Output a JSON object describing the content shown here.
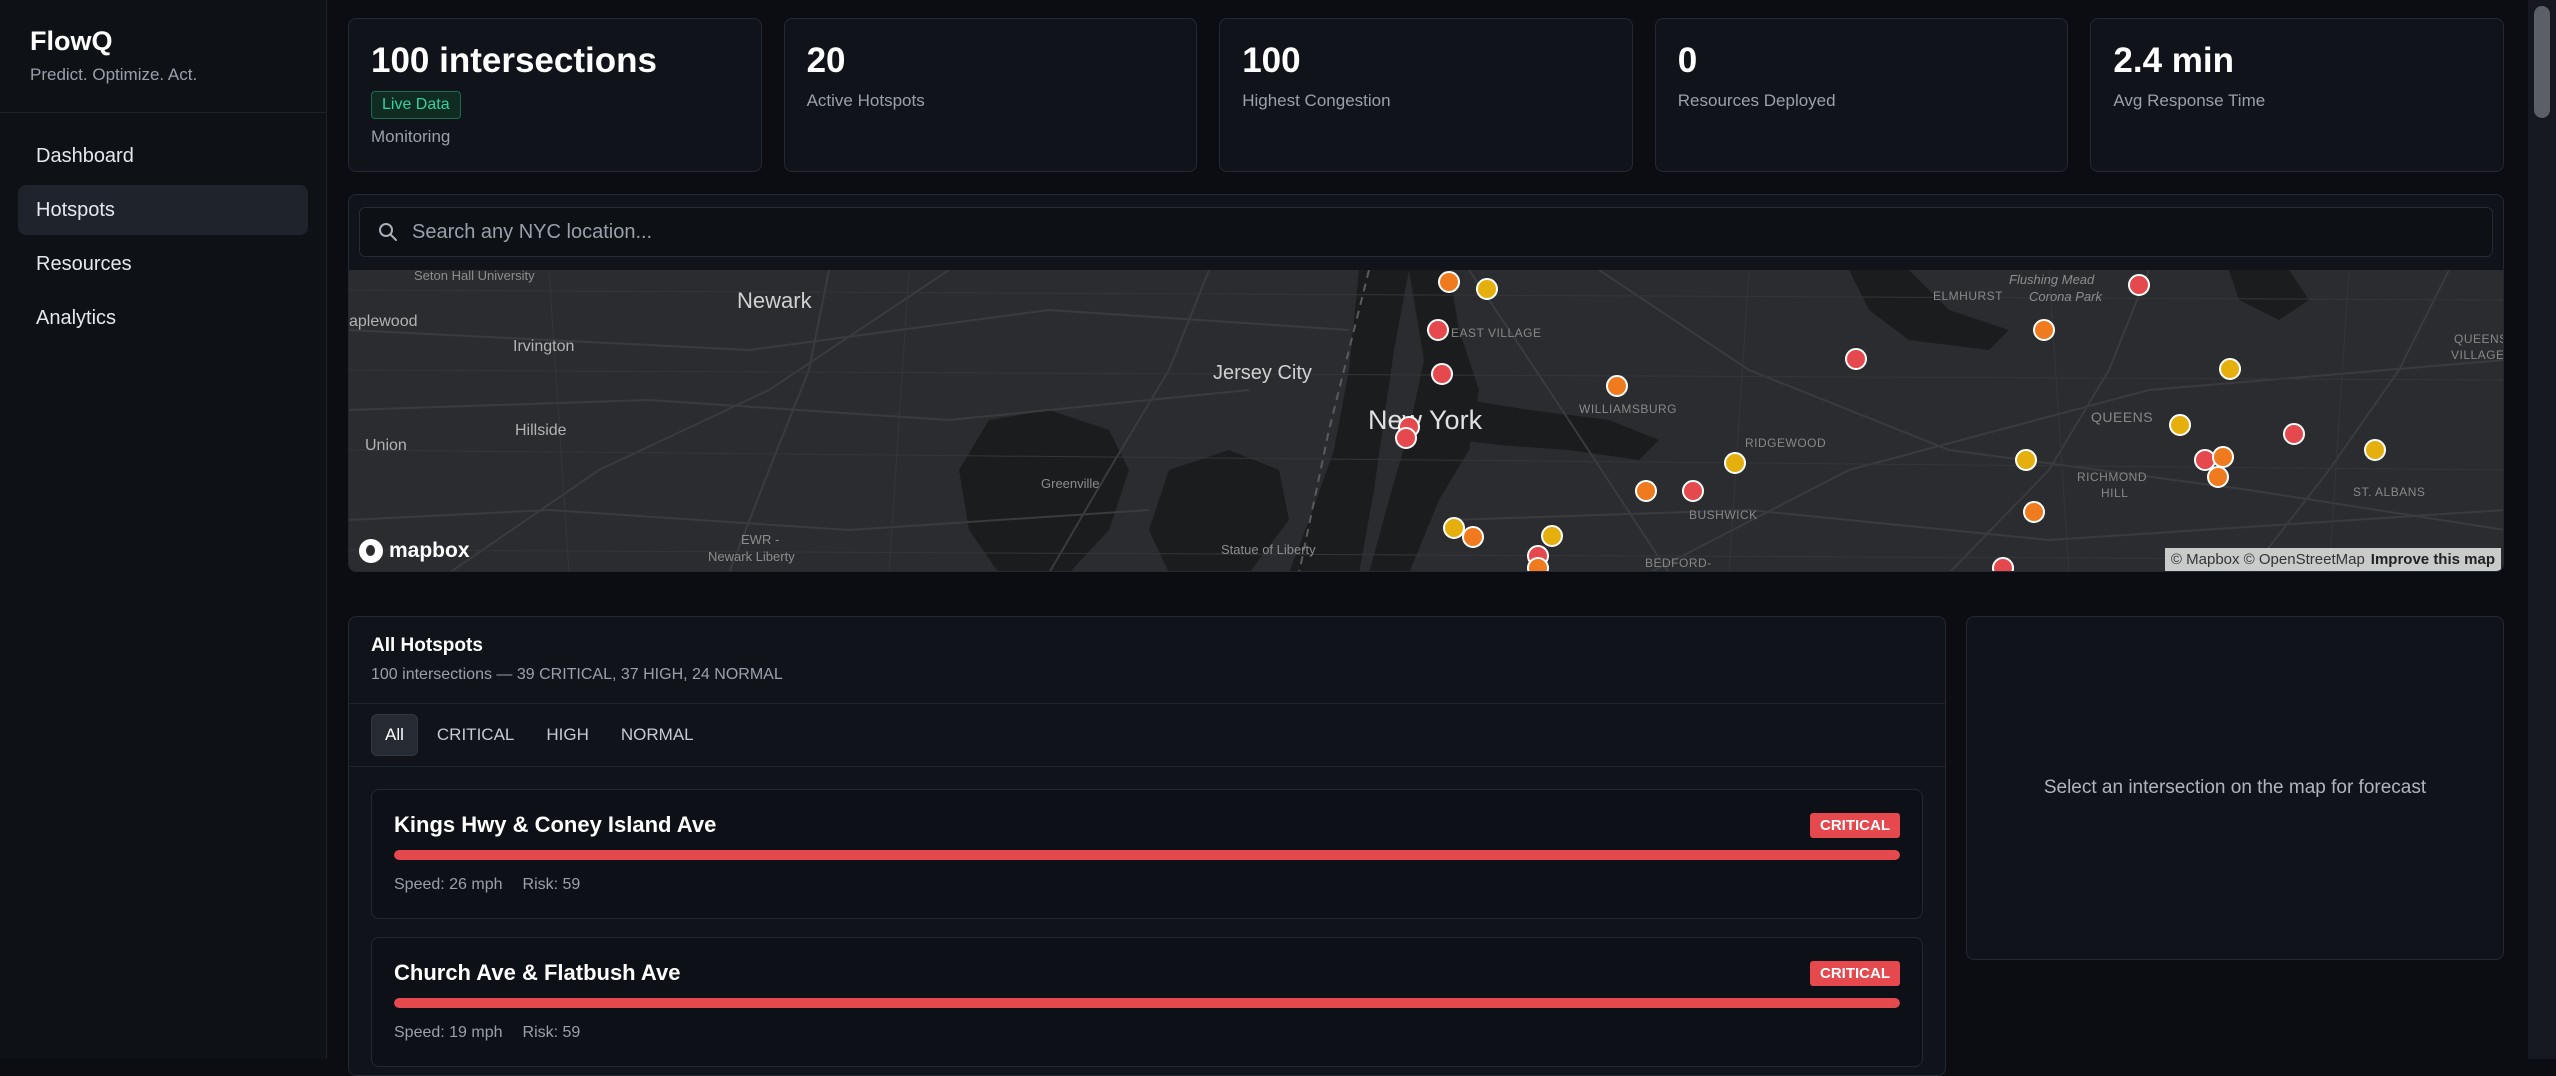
{
  "brand": {
    "title": "FlowQ",
    "tagline": "Predict. Optimize. Act."
  },
  "sidebar": {
    "items": [
      {
        "label": "Dashboard",
        "active": false
      },
      {
        "label": "Hotspots",
        "active": true
      },
      {
        "label": "Resources",
        "active": false
      },
      {
        "label": "Analytics",
        "active": false
      }
    ]
  },
  "kpis": {
    "monitoring": {
      "value": "100 intersections",
      "badge": "Live Data",
      "label": "Monitoring"
    },
    "hotspots": {
      "value": "20",
      "label": "Active Hotspots"
    },
    "congestion": {
      "value": "100",
      "label": "Highest Congestion"
    },
    "resources": {
      "value": "0",
      "label": "Resources Deployed"
    },
    "response": {
      "value": "2.4 min",
      "label": "Avg Response Time"
    }
  },
  "search": {
    "placeholder": "Search any NYC location..."
  },
  "map": {
    "labels": {
      "seton_hall": "Seton Hall University",
      "newark": "Newark",
      "maplewood": "aplewood",
      "irvington": "Irvington",
      "union": "Union",
      "hillside": "Hillside",
      "ewr": "EWR -",
      "ewr2": "Newark Liberty",
      "greenville": "Greenville",
      "jersey_city": "Jersey City",
      "statue": "Statue of Liberty",
      "new_york": "New York",
      "east_village": "EAST VILLAGE",
      "williamsburg": "WILLIAMSBURG",
      "ridgewood": "RIDGEWOOD",
      "bushwick": "BUSHWICK",
      "bedford": "BEDFORD-",
      "elmhurst": "ELMHURST",
      "flushing": "Flushing Mead",
      "corona": "Corona Park",
      "queens": "QUEENS",
      "richmond_hill": "RICHMOND",
      "richmond_hill2": "HILL",
      "queens_village": "QUEENS",
      "queens_village2": "VILLAGE",
      "st_albans": "ST. ALBANS"
    },
    "logo": "mapbox",
    "attribution": "© Mapbox © OpenStreetMap",
    "improve": "Improve this map",
    "marker_colors": {
      "critical": "#e5484d",
      "high": "#f07a1e",
      "normal": "#e5b00e"
    }
  },
  "hotspots": {
    "title": "All Hotspots",
    "summary": "100 intersections — 39 CRITICAL, 37 HIGH, 24 NORMAL",
    "filters": [
      "All",
      "CRITICAL",
      "HIGH",
      "NORMAL"
    ],
    "active_filter": "All",
    "items": [
      {
        "name": "Kings Hwy & Coney Island Ave",
        "level": "CRITICAL",
        "speed": "Speed: 26 mph",
        "risk": "Risk: 59",
        "congestion": 100
      },
      {
        "name": "Church Ave & Flatbush Ave",
        "level": "CRITICAL",
        "speed": "Speed: 19 mph",
        "risk": "Risk: 59",
        "congestion": 100
      }
    ]
  },
  "forecast": {
    "message": "Select an intersection on the map for forecast"
  }
}
